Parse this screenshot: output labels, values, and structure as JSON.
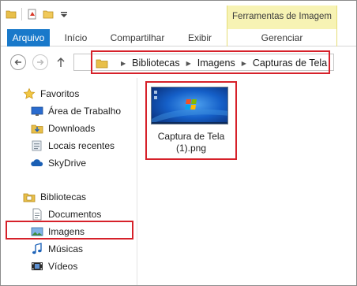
{
  "ribbon": {
    "contextual_header": "Ferramentas de Imagem",
    "tabs": [
      {
        "label": "Arquivo"
      },
      {
        "label": "Início"
      },
      {
        "label": "Compartilhar"
      },
      {
        "label": "Exibir"
      },
      {
        "label": "Gerenciar"
      }
    ]
  },
  "address_bar": {
    "breadcrumbs": [
      "Bibliotecas",
      "Imagens",
      "Capturas de Tela"
    ]
  },
  "nav_pane": {
    "favorites": {
      "label": "Favoritos",
      "items": [
        {
          "label": "Área de Trabalho",
          "icon": "desktop-icon"
        },
        {
          "label": "Downloads",
          "icon": "downloads-icon"
        },
        {
          "label": "Locais recentes",
          "icon": "recent-places-icon"
        },
        {
          "label": "SkyDrive",
          "icon": "skydrive-icon"
        }
      ]
    },
    "libraries": {
      "label": "Bibliotecas",
      "items": [
        {
          "label": "Documentos",
          "icon": "documents-icon"
        },
        {
          "label": "Imagens",
          "icon": "pictures-icon",
          "selected": true
        },
        {
          "label": "Músicas",
          "icon": "music-icon"
        },
        {
          "label": "Vídeos",
          "icon": "videos-icon"
        }
      ]
    }
  },
  "content": {
    "files": [
      {
        "name": "Captura de Tela (1).png",
        "name_line1": "Captura de Tela",
        "name_line2": "(1).png"
      }
    ]
  },
  "colors": {
    "file_tab": "#1979ca",
    "contextual_tab": "#f7f3b4",
    "highlight_border": "#d6212a"
  }
}
